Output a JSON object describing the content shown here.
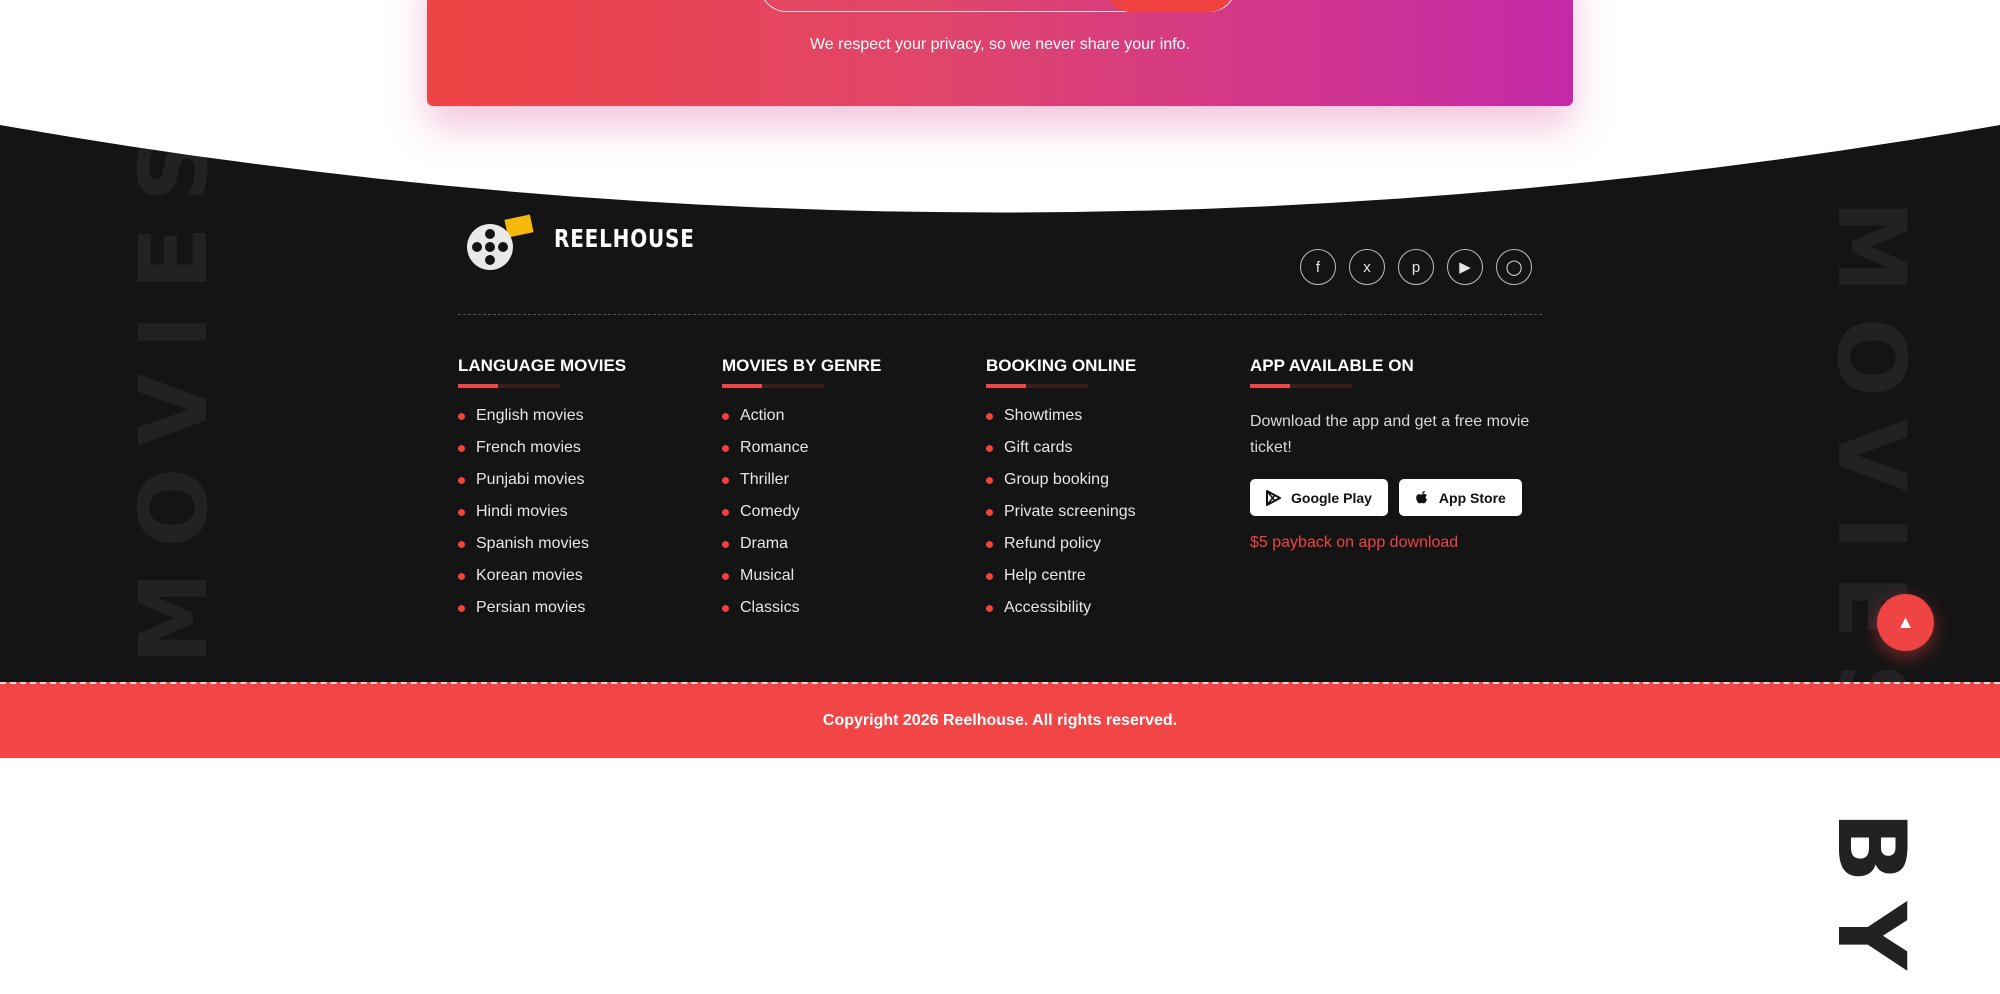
{
  "newsletter": {
    "privacy_note": "We respect your privacy, so we never share your info."
  },
  "background_text": "MOVIES BY",
  "brand": {
    "name": "REELHOUSE"
  },
  "socials": [
    {
      "icon": "facebook-icon",
      "glyph": "f"
    },
    {
      "icon": "x-icon",
      "glyph": "x"
    },
    {
      "icon": "pinterest-icon",
      "glyph": "p"
    },
    {
      "icon": "youtube-icon",
      "glyph": "▶"
    },
    {
      "icon": "instagram-icon",
      "glyph": "◯"
    }
  ],
  "columns": {
    "language": {
      "title": "LANGUAGE MOVIES",
      "items": [
        "English movies",
        "French movies",
        "Punjabi movies",
        "Hindi movies",
        "Spanish movies",
        "Korean movies",
        "Persian movies"
      ]
    },
    "genre": {
      "title": "MOVIES BY GENRE",
      "items": [
        "Action",
        "Romance",
        "Thriller",
        "Comedy",
        "Drama",
        "Musical",
        "Classics"
      ]
    },
    "booking": {
      "title": "BOOKING ONLINE",
      "items": [
        "Showtimes",
        "Gift cards",
        "Group booking",
        "Private screenings",
        "Refund policy",
        "Help centre",
        "Accessibility"
      ]
    },
    "app": {
      "title": "APP AVAILABLE ON",
      "description": "Download the app and get a free movie ticket!",
      "google_play": "Google Play",
      "app_store": "App Store",
      "payback": "$5 payback on app download"
    }
  },
  "scroll_top": {
    "glyph": "▲"
  },
  "copyright": "Copyright 2026 Reelhouse. All rights reserved.",
  "colors": {
    "accent": "#ef4444",
    "footer_bg": "#141414",
    "copyright_bg": "#f24545",
    "gradient_start": "#ef4444",
    "gradient_end": "#c42aa8"
  }
}
